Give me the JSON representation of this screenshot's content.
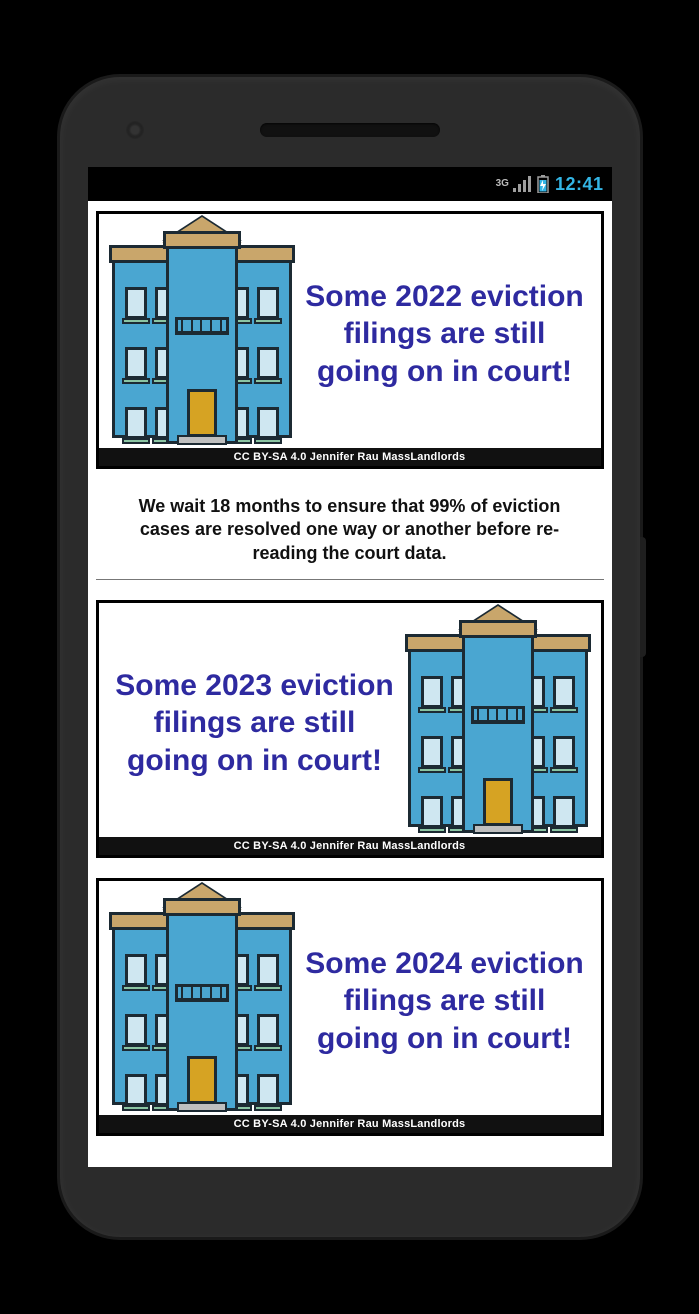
{
  "status": {
    "network": "3G",
    "time": "12:41"
  },
  "cards": [
    {
      "headline": "Some 2022 eviction filings are still going on in court!",
      "credit": "CC BY-SA 4.0 Jennifer Rau MassLandlords"
    },
    {
      "headline": "Some 2023 eviction filings are still going on in court!",
      "credit": "CC BY-SA 4.0 Jennifer Rau MassLandlords"
    },
    {
      "headline": "Some 2024 eviction filings are still going on in court!",
      "credit": "CC BY-SA 4.0 Jennifer Rau MassLandlords"
    }
  ],
  "caption": "We wait 18 months to ensure that 99% of eviction cases are resolved one way or another before re-reading the court data."
}
